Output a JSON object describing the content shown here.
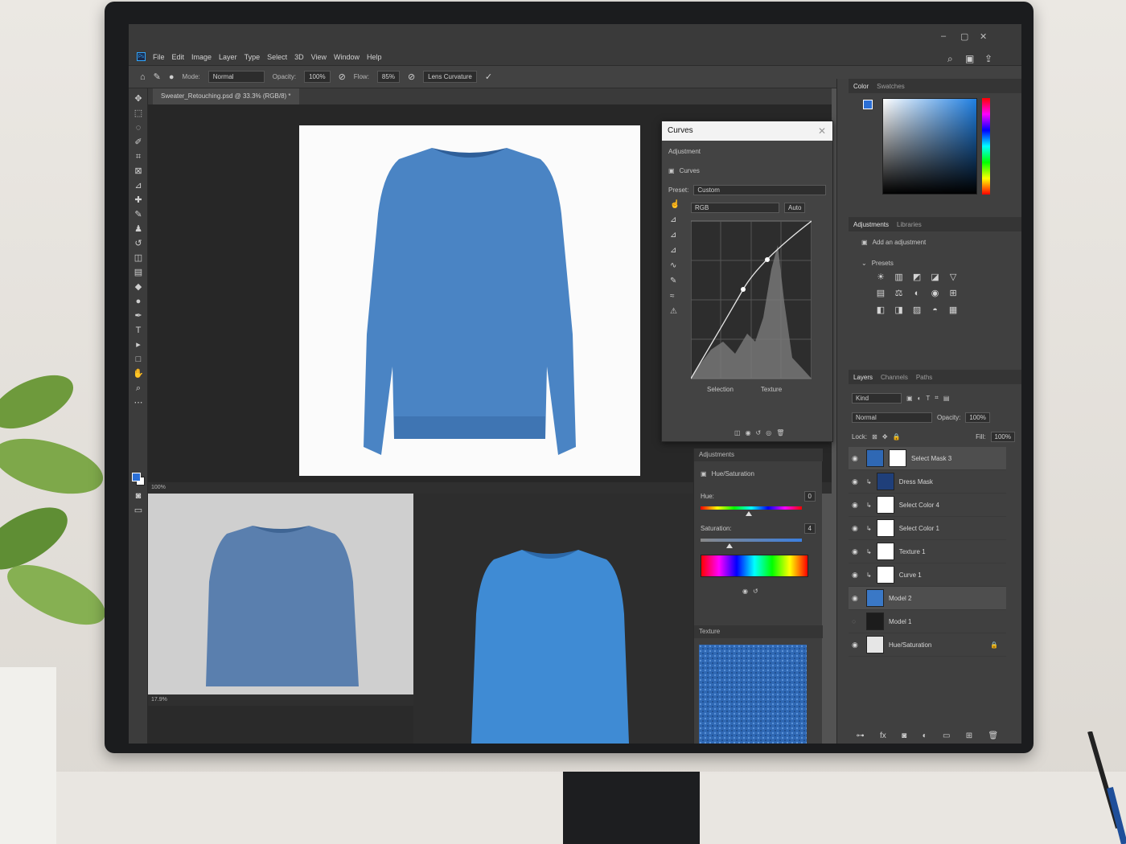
{
  "menu": [
    "File",
    "Edit",
    "Image",
    "Layer",
    "Type",
    "Select",
    "3D",
    "View",
    "Window",
    "Help"
  ],
  "options_bar": {
    "mode_label": "Mode:",
    "mode_value": "Normal",
    "opacity_label": "Opacity:",
    "opacity_value": "100%",
    "flow_label": "Flow:",
    "flow_value": "85%",
    "extra": "Lens Curvature"
  },
  "document_tab": "Sweater_Retouching.psd @ 33.3% (RGB/8) *",
  "status_top": "100%",
  "status_bottom": "17.9%",
  "curves": {
    "title": "Curves",
    "properties_label": "Adjustment",
    "layer_label": "Curves",
    "preset_label": "Preset:",
    "preset_value": "Custom",
    "channel_value": "RGB",
    "auto_label": "Auto",
    "input_label": "Selection",
    "output_label": "Texture"
  },
  "huesat": {
    "header": "Adjustments",
    "title": "Hue/Saturation",
    "hue_label": "Hue:",
    "hue_value": "0",
    "sat_label": "Saturation:",
    "sat_value": "4",
    "texture_header": "Texture"
  },
  "color_panel": {
    "tabs": [
      "Color",
      "Swatches"
    ]
  },
  "adjustments_panel": {
    "tabs": [
      "Adjustments",
      "Libraries"
    ],
    "add_label": "Add an adjustment",
    "presets_label": "Presets"
  },
  "layers_panel": {
    "tabs": [
      "Layers",
      "Channels",
      "Paths"
    ],
    "kind_value": "Kind",
    "blend_value": "Normal",
    "opacity_label": "Opacity:",
    "opacity_value": "100%",
    "lock_label": "Lock:",
    "fill_label": "Fill:",
    "fill_value": "100%",
    "layers": [
      {
        "name": "Select Mask 3"
      },
      {
        "name": "Dress Mask"
      },
      {
        "name": "Select Color 4"
      },
      {
        "name": "Select Color 1"
      },
      {
        "name": "Texture 1"
      },
      {
        "name": "Curve 1"
      },
      {
        "name": "Model 2"
      },
      {
        "name": "Model 1"
      },
      {
        "name": "Hue/Saturation"
      }
    ]
  },
  "colors": {
    "sweater": "#4a84c4",
    "sweater_dark": "#2f5f99",
    "accent": "#31a8ff"
  }
}
